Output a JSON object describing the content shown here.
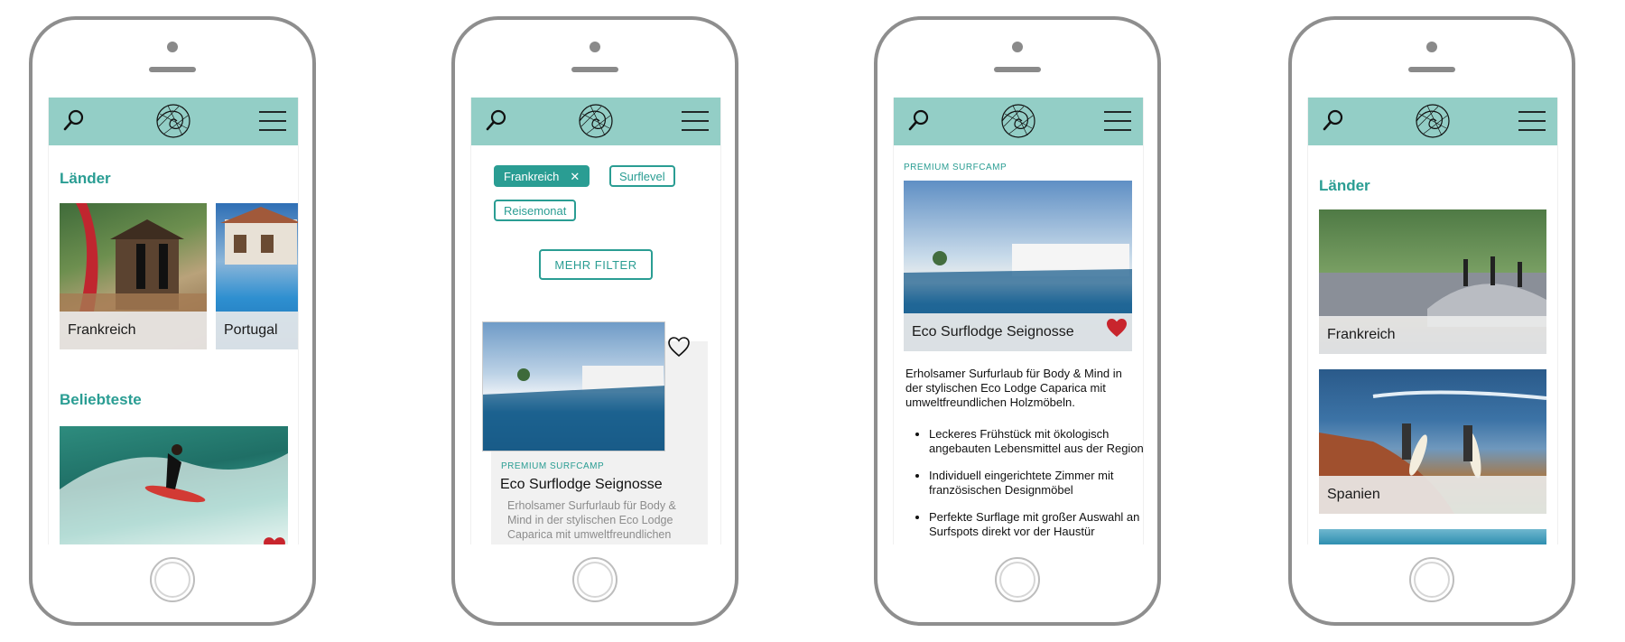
{
  "colors": {
    "header": "#93cec6",
    "accent": "#2a9d93",
    "heart": "#c8252d",
    "frame": "#8e8e8e"
  },
  "icons": {
    "search": "search-icon",
    "menu": "hamburger-menu-icon",
    "logo": "wave-logo-icon",
    "heart": "heart-icon",
    "remove": "close-icon"
  },
  "screen1": {
    "countries_title": "Länder",
    "countries": [
      {
        "label": "Frankreich"
      },
      {
        "label": "Portugal"
      }
    ],
    "popular_title": "Beliebteste"
  },
  "screen2": {
    "chips": [
      {
        "label": "Frankreich",
        "active": true
      },
      {
        "label": "Surflevel"
      },
      {
        "label": "Reisemonat"
      }
    ],
    "more_filter": "MEHR FILTER",
    "result": {
      "tag": "PREMIUM SURFCAMP",
      "title": "Eco Surflodge Seignosse",
      "description": "Erholsamer Surfurlaub für Body & Mind in der stylischen Eco Lodge Caparica mit umweltfreundlichen"
    }
  },
  "screen3": {
    "tag": "PREMIUM SURFCAMP",
    "title": "Eco Surflodge Seignosse",
    "intro": "Erholsamer Surfurlaub für Body & Mind in der stylischen Eco Lodge Caparica mit umweltfreundlichen Holzmöbeln.",
    "bullets": [
      "Leckeres Frühstück mit ökologisch angebauten Lebensmittel aus der Region",
      "Individuell eingerichtete Zimmer mit französischen Designmöbel",
      "Perfekte Surflage mit großer Auswahl an Surfspots direkt vor der Haustür"
    ]
  },
  "screen4": {
    "countries_title": "Länder",
    "countries": [
      {
        "label": "Frankreich"
      },
      {
        "label": "Spanien"
      }
    ]
  }
}
